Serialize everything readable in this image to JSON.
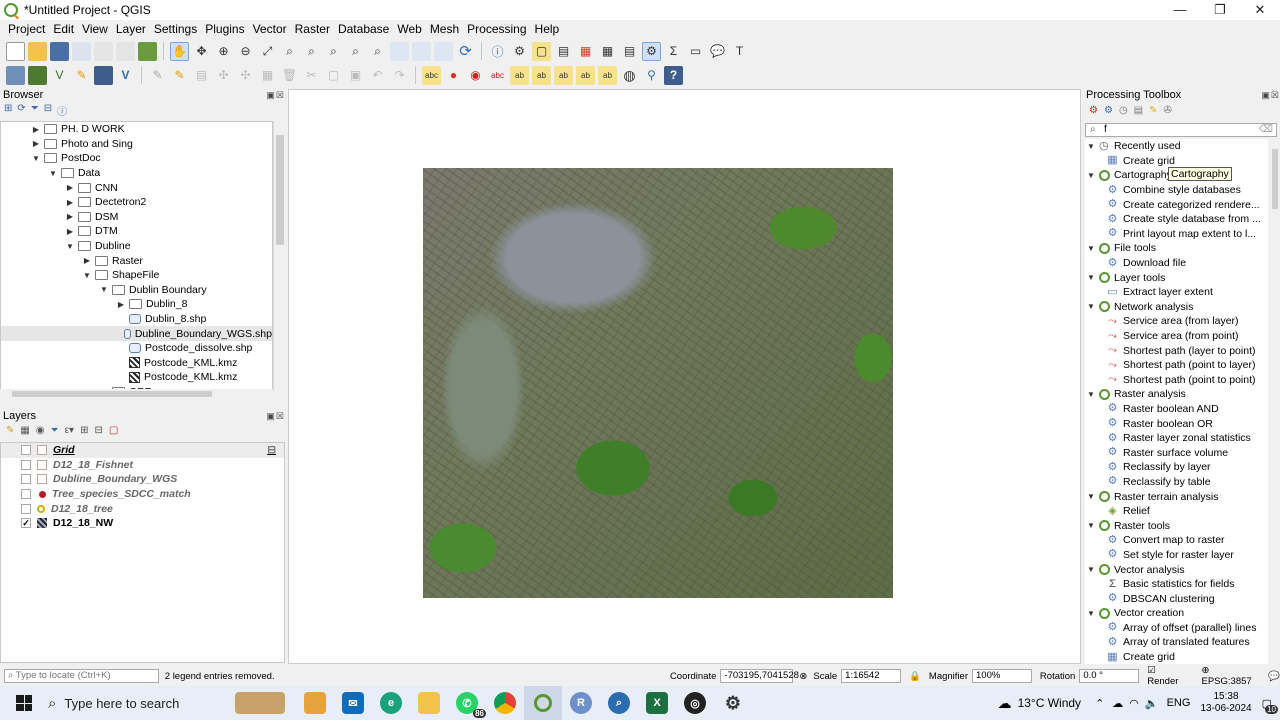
{
  "window": {
    "title": "*Untitled Project - QGIS",
    "controls": [
      "—",
      "❐",
      "✕"
    ]
  },
  "menu": [
    "Project",
    "Edit",
    "View",
    "Layer",
    "Settings",
    "Plugins",
    "Vector",
    "Raster",
    "Database",
    "Web",
    "Mesh",
    "Processing",
    "Help"
  ],
  "browser": {
    "title": "Browser",
    "items": [
      {
        "label": "PH. D WORK",
        "indent": 2,
        "arrow": "▶",
        "icon": "folder"
      },
      {
        "label": "Photo and Sing",
        "indent": 2,
        "arrow": "▶",
        "icon": "folder"
      },
      {
        "label": "PostDoc",
        "indent": 2,
        "arrow": "▼",
        "icon": "folder"
      },
      {
        "label": "Data",
        "indent": 3,
        "arrow": "▼",
        "icon": "folder"
      },
      {
        "label": "CNN",
        "indent": 4,
        "arrow": "▶",
        "icon": "folder"
      },
      {
        "label": "Dectetron2",
        "indent": 4,
        "arrow": "▶",
        "icon": "folder"
      },
      {
        "label": "DSM",
        "indent": 4,
        "arrow": "▶",
        "icon": "folder"
      },
      {
        "label": "DTM",
        "indent": 4,
        "arrow": "▶",
        "icon": "folder"
      },
      {
        "label": "Dubline",
        "indent": 4,
        "arrow": "▼",
        "icon": "folder"
      },
      {
        "label": "Raster",
        "indent": 5,
        "arrow": "▶",
        "icon": "folder"
      },
      {
        "label": "ShapeFile",
        "indent": 5,
        "arrow": "▼",
        "icon": "folder"
      },
      {
        "label": "Dublin Boundary",
        "indent": 6,
        "arrow": "▼",
        "icon": "folder"
      },
      {
        "label": "Dublin_8",
        "indent": 7,
        "arrow": "▶",
        "icon": "folder"
      },
      {
        "label": "Dublin_8.shp",
        "indent": 7,
        "arrow": "",
        "icon": "file"
      },
      {
        "label": "Dubline_Boundary_WGS.shp",
        "indent": 7,
        "arrow": "",
        "icon": "file",
        "selected": true
      },
      {
        "label": "Postcode_dissolve.shp",
        "indent": 7,
        "arrow": "",
        "icon": "file"
      },
      {
        "label": "Postcode_KML.kmz",
        "indent": 7,
        "arrow": "",
        "icon": "raster"
      },
      {
        "label": "Postcode_KML.kmz",
        "indent": 7,
        "arrow": "",
        "icon": "raster"
      },
      {
        "label": "GRP",
        "indent": 6,
        "arrow": "",
        "icon": "folder"
      }
    ]
  },
  "layers": {
    "title": "Layers",
    "items": [
      {
        "label": "Grid",
        "checked": false,
        "symbol": "square-outline",
        "style": "grid"
      },
      {
        "label": "D12_18_Fishnet",
        "checked": false,
        "symbol": "square-outline",
        "style": ""
      },
      {
        "label": "Dubline_Boundary_WGS",
        "checked": false,
        "symbol": "square-outline",
        "style": ""
      },
      {
        "label": "Tree_species_SDCC_match",
        "checked": false,
        "symbol": "red-dot",
        "style": ""
      },
      {
        "label": "D12_18_tree",
        "checked": false,
        "symbol": "yellow-circle",
        "style": ""
      },
      {
        "label": "D12_18_NW",
        "checked": true,
        "symbol": "raster",
        "style": "active"
      }
    ]
  },
  "toolbox": {
    "title": "Processing Toolbox",
    "search_value": "f",
    "tooltip": "Cartography",
    "groups": [
      {
        "label": "Recently used",
        "icon": "clock",
        "items": [
          {
            "label": "Create grid",
            "icon": "grid"
          }
        ]
      },
      {
        "label": "Cartography",
        "icon": "qgis",
        "items": [
          {
            "label": "Combine style databases",
            "icon": "gear"
          },
          {
            "label": "Create categorized rendere...",
            "icon": "gear"
          },
          {
            "label": "Create style database from ...",
            "icon": "gear"
          },
          {
            "label": "Print layout map extent to l...",
            "icon": "gear"
          }
        ]
      },
      {
        "label": "File tools",
        "icon": "qgis",
        "items": [
          {
            "label": "Download file",
            "icon": "gear"
          }
        ]
      },
      {
        "label": "Layer tools",
        "icon": "qgis",
        "items": [
          {
            "label": "Extract layer extent",
            "icon": "extent"
          }
        ]
      },
      {
        "label": "Network analysis",
        "icon": "qgis",
        "items": [
          {
            "label": "Service area (from layer)",
            "icon": "network"
          },
          {
            "label": "Service area (from point)",
            "icon": "network"
          },
          {
            "label": "Shortest path (layer to point)",
            "icon": "network"
          },
          {
            "label": "Shortest path (point to layer)",
            "icon": "network"
          },
          {
            "label": "Shortest path (point to point)",
            "icon": "network"
          }
        ]
      },
      {
        "label": "Raster analysis",
        "icon": "qgis",
        "items": [
          {
            "label": "Raster boolean AND",
            "icon": "gear"
          },
          {
            "label": "Raster boolean OR",
            "icon": "gear"
          },
          {
            "label": "Raster layer zonal statistics",
            "icon": "gear"
          },
          {
            "label": "Raster surface volume",
            "icon": "gear"
          },
          {
            "label": "Reclassify by layer",
            "icon": "gear"
          },
          {
            "label": "Reclassify by table",
            "icon": "gear"
          }
        ]
      },
      {
        "label": "Raster terrain analysis",
        "icon": "qgis",
        "items": [
          {
            "label": "Relief",
            "icon": "relief"
          }
        ]
      },
      {
        "label": "Raster tools",
        "icon": "qgis",
        "items": [
          {
            "label": "Convert map to raster",
            "icon": "gear"
          },
          {
            "label": "Set style for raster layer",
            "icon": "gear"
          }
        ]
      },
      {
        "label": "Vector analysis",
        "icon": "qgis",
        "items": [
          {
            "label": "Basic statistics for fields",
            "icon": "sigma"
          },
          {
            "label": "DBSCAN clustering",
            "icon": "gear"
          }
        ]
      },
      {
        "label": "Vector creation",
        "icon": "qgis",
        "items": [
          {
            "label": "Array of offset (parallel) lines",
            "icon": "gear"
          },
          {
            "label": "Array of translated features",
            "icon": "gear"
          },
          {
            "label": "Create grid",
            "icon": "grid"
          }
        ]
      }
    ]
  },
  "statusbar": {
    "locate_placeholder": "Type to locate (Ctrl+K)",
    "message": "2 legend entries removed.",
    "coordinate_label": "Coordinate",
    "coordinate": "-703195,7041528",
    "scale_label": "Scale",
    "scale": "1:16542",
    "magnifier_label": "Magnifier",
    "magnifier": "100%",
    "rotation_label": "Rotation",
    "rotation": "0.0 °",
    "render_label": "Render",
    "crs": "EPSG:3857"
  },
  "taskbar": {
    "search_placeholder": "Type here to search",
    "whatsapp_badge": "86",
    "weather": "13°C  Windy",
    "language": "ENG",
    "time": "15:38",
    "date": "13-06-2024",
    "notifications": "10"
  },
  "colors": {
    "qgis_green": "#589632",
    "accent_blue": "#0078d4",
    "canvas_bg": "#ffffff"
  }
}
